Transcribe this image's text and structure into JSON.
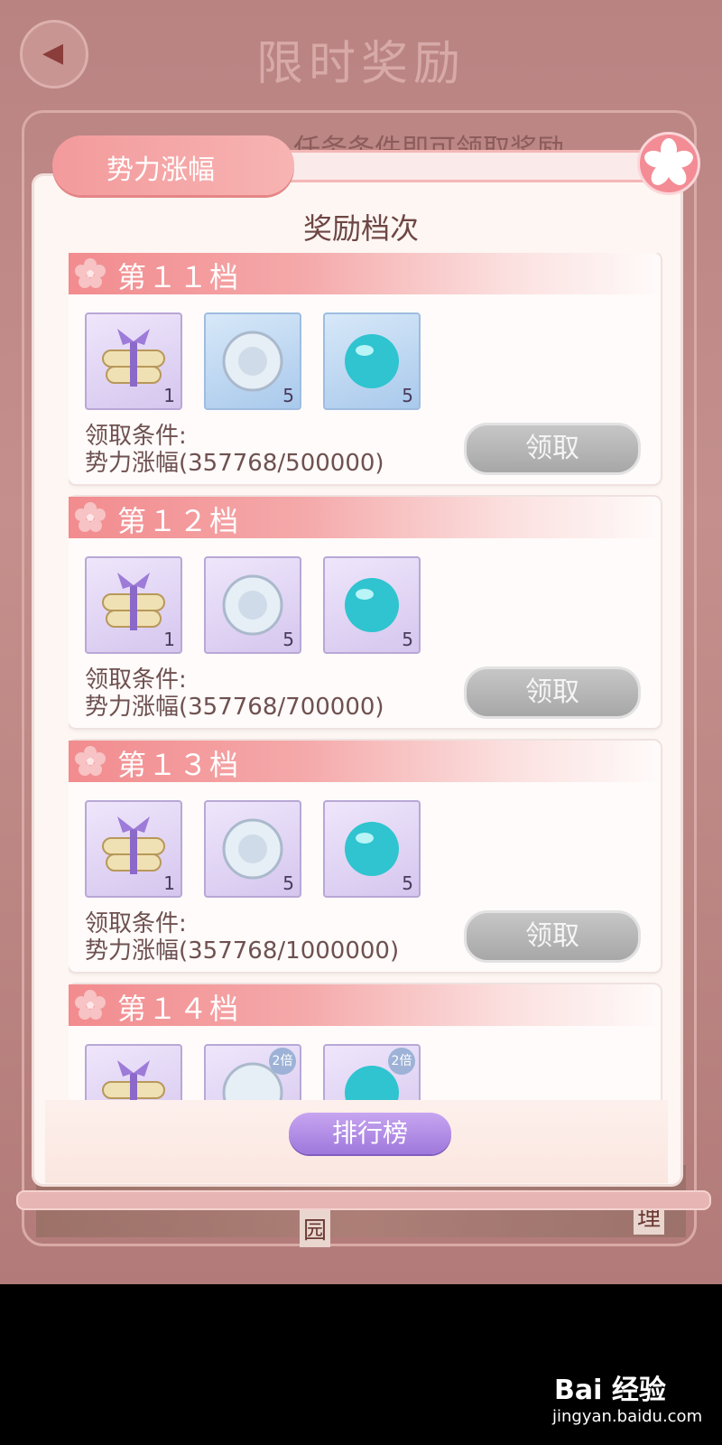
{
  "background": {
    "title": "限时奖励",
    "subtitle": "任务条件即可领取奖励",
    "chars": [
      "理",
      "园"
    ]
  },
  "header": {
    "tab_label": "势力涨幅",
    "panel_heading": "奖励档次"
  },
  "tiers": [
    {
      "title": "第１１档",
      "items": [
        {
          "icon": "gift-scroll-bundle-icon",
          "count": "1",
          "double": ""
        },
        {
          "icon": "silver-flower-coin-icon",
          "count": "5",
          "double": ""
        },
        {
          "icon": "cyan-orb-icon",
          "count": "5",
          "double": ""
        }
      ],
      "condition_label": "领取条件:",
      "condition_value": "势力涨幅(357768/500000)",
      "claim_label": "领取"
    },
    {
      "title": "第１２档",
      "items": [
        {
          "icon": "gift-scroll-bundle-icon",
          "count": "1",
          "double": ""
        },
        {
          "icon": "silver-flower-coin-icon",
          "count": "5",
          "double": ""
        },
        {
          "icon": "cyan-orb-icon",
          "count": "5",
          "double": ""
        }
      ],
      "condition_label": "领取条件:",
      "condition_value": "势力涨幅(357768/700000)",
      "claim_label": "领取"
    },
    {
      "title": "第１３档",
      "items": [
        {
          "icon": "gift-scroll-bundle-icon",
          "count": "1",
          "double": ""
        },
        {
          "icon": "silver-flower-coin-icon",
          "count": "5",
          "double": ""
        },
        {
          "icon": "cyan-orb-icon",
          "count": "5",
          "double": ""
        }
      ],
      "condition_label": "领取条件:",
      "condition_value": "势力涨幅(357768/1000000)",
      "claim_label": "领取"
    },
    {
      "title": "第１４档",
      "items": [
        {
          "icon": "gift-scroll-bundle-icon",
          "count": "",
          "double": ""
        },
        {
          "icon": "silver-flower-coin-icon",
          "count": "",
          "double": "2倍"
        },
        {
          "icon": "cyan-orb-icon",
          "count": "",
          "double": "2倍"
        }
      ],
      "condition_label": "",
      "condition_value": "",
      "claim_label": ""
    }
  ],
  "footer": {
    "rank_label": "排行榜"
  },
  "watermark": {
    "logo": "Bai 经验",
    "url": "jingyan.baidu.com"
  },
  "colors": {
    "accent_pink": "#f28b8e",
    "claim_disabled": "#a7a7a7",
    "rank_purple": "#9f78dc"
  }
}
